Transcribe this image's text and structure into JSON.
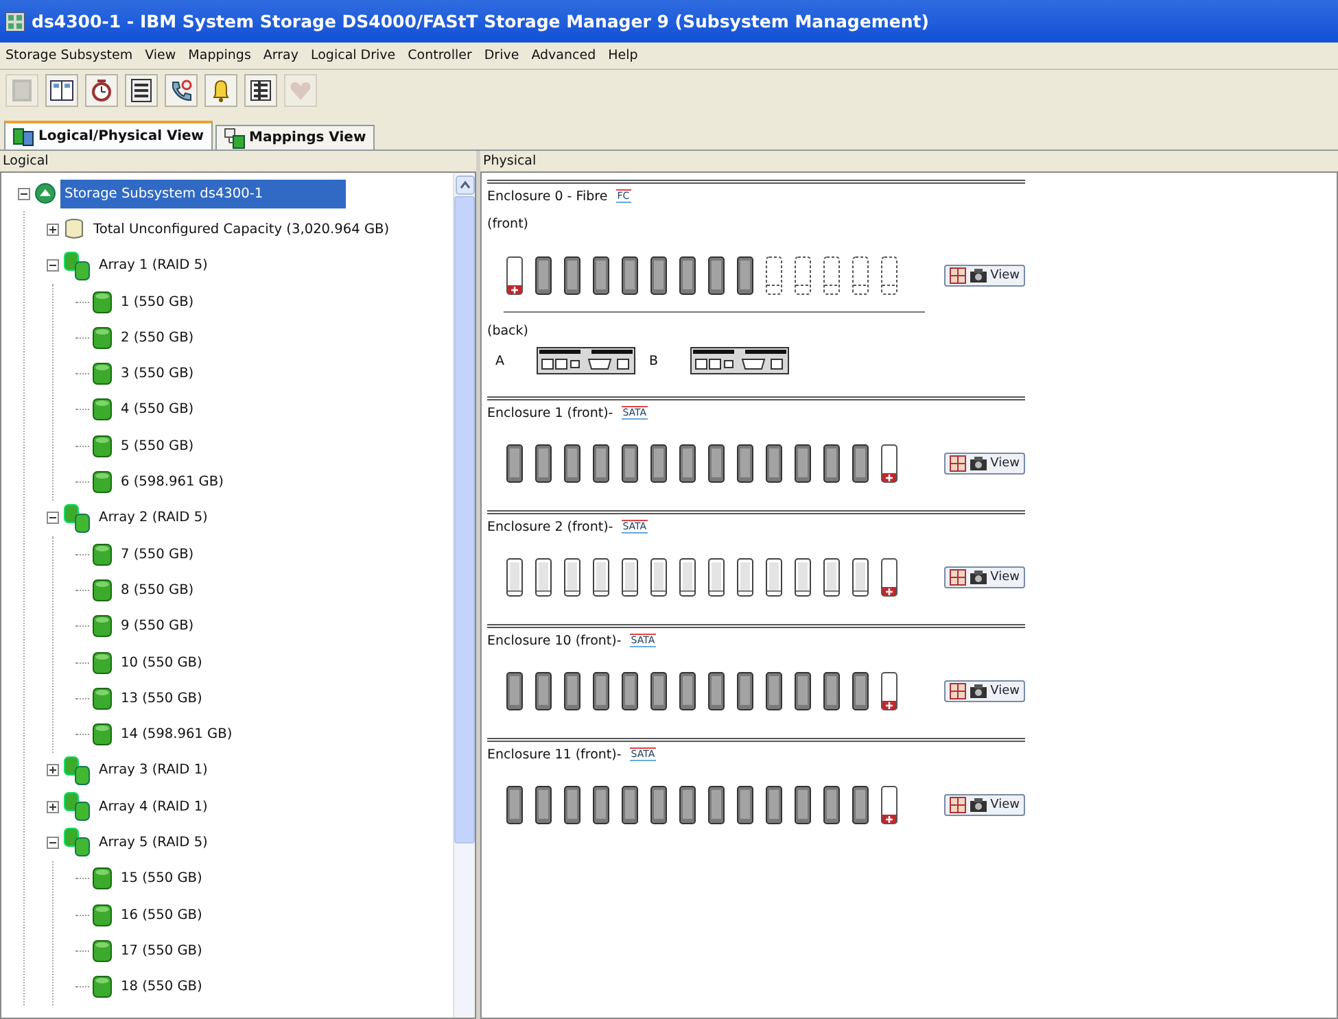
{
  "window": {
    "title": "ds4300-1 - IBM System Storage DS4000/FAStT Storage Manager 9 (Subsystem Management)"
  },
  "menu": [
    "Storage Subsystem",
    "View",
    "Mappings",
    "Array",
    "Logical Drive",
    "Controller",
    "Drive",
    "Advanced",
    "Help"
  ],
  "toolbar": [
    {
      "kind": "disk",
      "disabled": true
    },
    {
      "kind": "panes",
      "disabled": false
    },
    {
      "kind": "clock",
      "disabled": false
    },
    {
      "kind": "list",
      "disabled": false
    },
    {
      "kind": "phone",
      "disabled": false
    },
    {
      "kind": "bell",
      "disabled": false
    },
    {
      "kind": "rack",
      "disabled": false
    },
    {
      "kind": "heart",
      "disabled": true
    }
  ],
  "tabs": [
    {
      "label": "Logical/Physical View",
      "selected": true,
      "kind": "logical"
    },
    {
      "label": "Mappings View",
      "selected": false,
      "kind": "mappings"
    }
  ],
  "logical": {
    "header": "Logical",
    "tree": [
      {
        "label": "Storage Subsystem ds4300-1",
        "kind": "subsystem",
        "selected": true,
        "expanded": true,
        "children": [
          {
            "label": "Total Unconfigured Capacity (3,020.964 GB)",
            "kind": "unconfigured",
            "selected": false,
            "expanded": false
          },
          {
            "label": "Array 1 (RAID 5)",
            "kind": "array",
            "selected": false,
            "expanded": true,
            "children": [
              {
                "label": "1 (550 GB)",
                "kind": "drive",
                "selected": false
              },
              {
                "label": "2 (550 GB)",
                "kind": "drive",
                "selected": false
              },
              {
                "label": "3 (550 GB)",
                "kind": "drive",
                "selected": false
              },
              {
                "label": "4 (550 GB)",
                "kind": "drive",
                "selected": false
              },
              {
                "label": "5 (550 GB)",
                "kind": "drive",
                "selected": false
              },
              {
                "label": "6 (598.961 GB)",
                "kind": "drive",
                "selected": false
              }
            ]
          },
          {
            "label": "Array 2 (RAID 5)",
            "kind": "array",
            "selected": false,
            "expanded": true,
            "children": [
              {
                "label": "7 (550 GB)",
                "kind": "drive",
                "selected": false
              },
              {
                "label": "8 (550 GB)",
                "kind": "drive",
                "selected": false
              },
              {
                "label": "9 (550 GB)",
                "kind": "drive",
                "selected": false
              },
              {
                "label": "10 (550 GB)",
                "kind": "drive",
                "selected": false
              },
              {
                "label": "13 (550 GB)",
                "kind": "drive",
                "selected": false
              },
              {
                "label": "14 (598.961 GB)",
                "kind": "drive",
                "selected": false
              }
            ]
          },
          {
            "label": "Array 3 (RAID 1)",
            "kind": "array",
            "selected": false,
            "expanded": false
          },
          {
            "label": "Array 4 (RAID 1)",
            "kind": "array",
            "selected": false,
            "expanded": false
          },
          {
            "label": "Array 5 (RAID 5)",
            "kind": "array",
            "selected": false,
            "expanded": true,
            "children": [
              {
                "label": "15 (550 GB)",
                "kind": "drive",
                "selected": false
              },
              {
                "label": "16 (550 GB)",
                "kind": "drive",
                "selected": false
              },
              {
                "label": "17 (550 GB)",
                "kind": "drive",
                "selected": false
              },
              {
                "label": "18 (550 GB)",
                "kind": "drive",
                "selected": false
              }
            ]
          }
        ]
      }
    ]
  },
  "physical": {
    "header": "Physical",
    "enclosures": [
      {
        "title": "Enclosure 0 - Fibre",
        "tag": "FC",
        "front_label": "(front)",
        "drives": [
          {
            "kind": "hotspare"
          },
          {
            "kind": "assigned"
          },
          {
            "kind": "assigned"
          },
          {
            "kind": "assigned"
          },
          {
            "kind": "assigned"
          },
          {
            "kind": "assigned"
          },
          {
            "kind": "assigned"
          },
          {
            "kind": "assigned"
          },
          {
            "kind": "assigned"
          },
          {
            "kind": "empty"
          },
          {
            "kind": "empty"
          },
          {
            "kind": "empty"
          },
          {
            "kind": "empty"
          },
          {
            "kind": "empty"
          }
        ],
        "view_button": "View",
        "back": {
          "label": "(back)",
          "controllers": [
            {
              "label": "A"
            },
            {
              "label": "B"
            }
          ]
        }
      },
      {
        "title": "Enclosure 1 (front)-",
        "tag": "SATA",
        "drives": [
          {
            "kind": "assigned"
          },
          {
            "kind": "assigned"
          },
          {
            "kind": "assigned"
          },
          {
            "kind": "assigned"
          },
          {
            "kind": "assigned"
          },
          {
            "kind": "assigned"
          },
          {
            "kind": "assigned"
          },
          {
            "kind": "assigned"
          },
          {
            "kind": "assigned"
          },
          {
            "kind": "assigned"
          },
          {
            "kind": "assigned"
          },
          {
            "kind": "assigned"
          },
          {
            "kind": "assigned"
          },
          {
            "kind": "hotspare"
          }
        ],
        "view_button": "View"
      },
      {
        "title": "Enclosure 2 (front)-",
        "tag": "SATA",
        "drives": [
          {
            "kind": "unassigned"
          },
          {
            "kind": "unassigned"
          },
          {
            "kind": "unassigned"
          },
          {
            "kind": "unassigned"
          },
          {
            "kind": "unassigned"
          },
          {
            "kind": "unassigned"
          },
          {
            "kind": "unassigned"
          },
          {
            "kind": "unassigned"
          },
          {
            "kind": "unassigned"
          },
          {
            "kind": "unassigned"
          },
          {
            "kind": "unassigned"
          },
          {
            "kind": "unassigned"
          },
          {
            "kind": "unassigned"
          },
          {
            "kind": "hotspare"
          }
        ],
        "view_button": "View"
      },
      {
        "title": "Enclosure 10 (front)-",
        "tag": "SATA",
        "drives": [
          {
            "kind": "assigned"
          },
          {
            "kind": "assigned"
          },
          {
            "kind": "assigned"
          },
          {
            "kind": "assigned"
          },
          {
            "kind": "assigned"
          },
          {
            "kind": "assigned"
          },
          {
            "kind": "assigned"
          },
          {
            "kind": "assigned"
          },
          {
            "kind": "assigned"
          },
          {
            "kind": "assigned"
          },
          {
            "kind": "assigned"
          },
          {
            "kind": "assigned"
          },
          {
            "kind": "assigned"
          },
          {
            "kind": "hotspare"
          }
        ],
        "view_button": "View"
      },
      {
        "title": "Enclosure 11 (front)-",
        "tag": "SATA",
        "drives": [
          {
            "kind": "assigned"
          },
          {
            "kind": "assigned"
          },
          {
            "kind": "assigned"
          },
          {
            "kind": "assigned"
          },
          {
            "kind": "assigned"
          },
          {
            "kind": "assigned"
          },
          {
            "kind": "assigned"
          },
          {
            "kind": "assigned"
          },
          {
            "kind": "assigned"
          },
          {
            "kind": "assigned"
          },
          {
            "kind": "assigned"
          },
          {
            "kind": "assigned"
          },
          {
            "kind": "assigned"
          },
          {
            "kind": "hotspare"
          }
        ],
        "view_button": "View"
      }
    ]
  }
}
